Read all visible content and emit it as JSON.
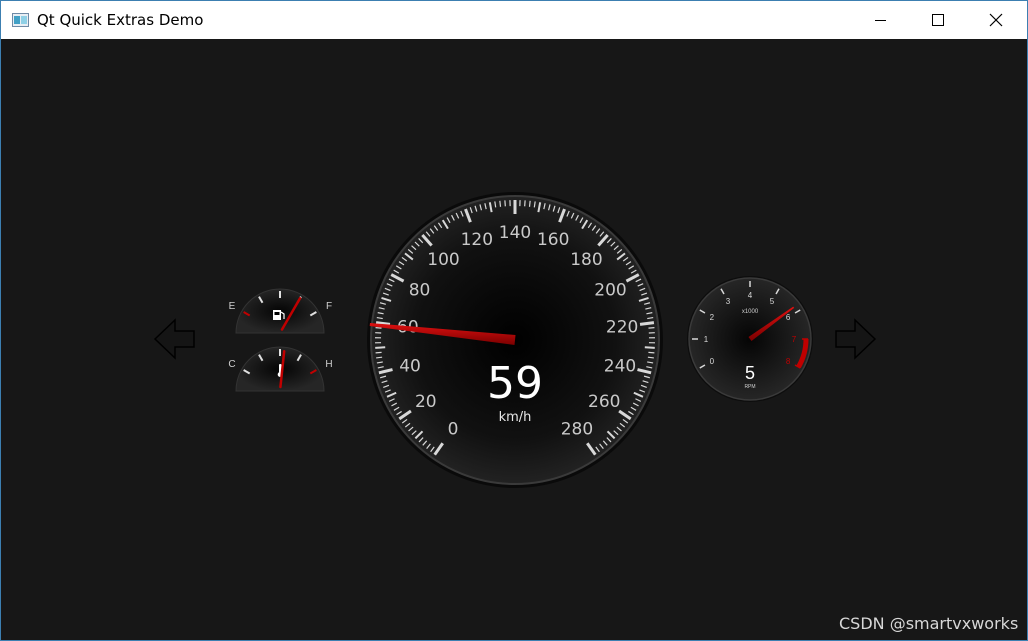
{
  "window": {
    "title": "Qt Quick Extras Demo",
    "icons": [
      "app-icon",
      "minimize-icon",
      "maximize-icon",
      "close-icon"
    ]
  },
  "dashboard": {
    "left_indicator": {
      "icon": "left-arrow-icon"
    },
    "right_indicator": {
      "icon": "right-arrow-icon"
    },
    "fuel_gauge": {
      "min_label": "E",
      "max_label": "F",
      "icon": "fuel-pump-icon",
      "level": 0.75
    },
    "temp_gauge": {
      "min_label": "C",
      "max_label": "H",
      "icon": "thermometer-icon",
      "level": 0.55
    },
    "speedometer": {
      "ticks": [
        "0",
        "20",
        "40",
        "60",
        "80",
        "100",
        "120",
        "140",
        "160",
        "180",
        "200",
        "220",
        "240",
        "260",
        "280"
      ],
      "value": "59",
      "unit": "km/h",
      "min": 0,
      "max": 280,
      "needle_value": 59
    },
    "tachometer": {
      "ticks": [
        "0",
        "1",
        "2",
        "3",
        "4",
        "5",
        "6",
        "7",
        "8"
      ],
      "multiplier": "x1000",
      "value": "5",
      "unit": "RPM",
      "min": 0,
      "max": 8,
      "needle_value": 5.8,
      "redline_from": 7
    }
  },
  "watermark": "CSDN @smartvxworks",
  "colors": {
    "accent_red": "#c00000",
    "label": "#c9c9c9",
    "background": "#171717"
  }
}
